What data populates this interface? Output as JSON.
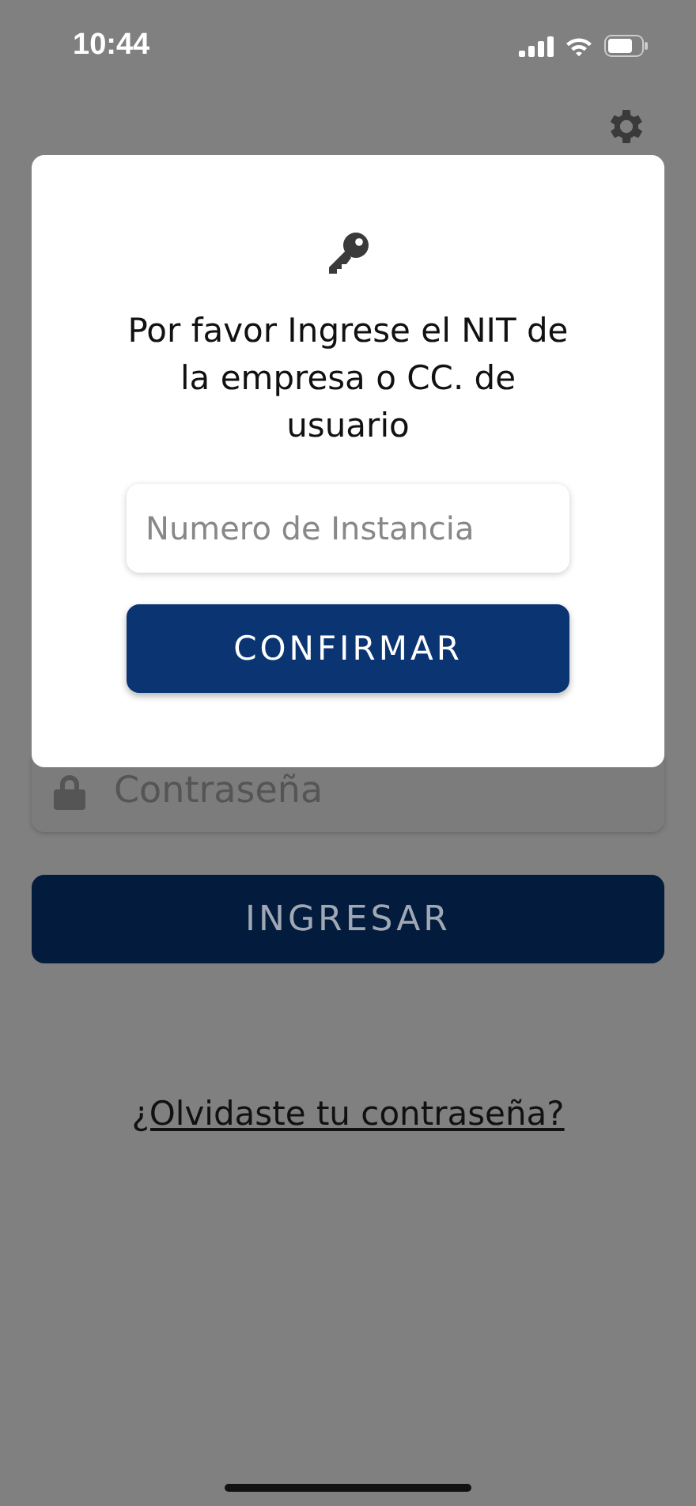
{
  "status_bar": {
    "time": "10:44"
  },
  "login": {
    "password_field": {
      "placeholder": "Contraseña"
    },
    "submit_button": "INGRESAR",
    "forgot_link": "¿Olvidaste tu contraseña?"
  },
  "dialog": {
    "message": "Por favor Ingrese el NIT de la empresa o CC. de usuario",
    "instance_field": {
      "placeholder": "Numero de Instancia"
    },
    "confirm_button": "CONFIRMAR"
  }
}
